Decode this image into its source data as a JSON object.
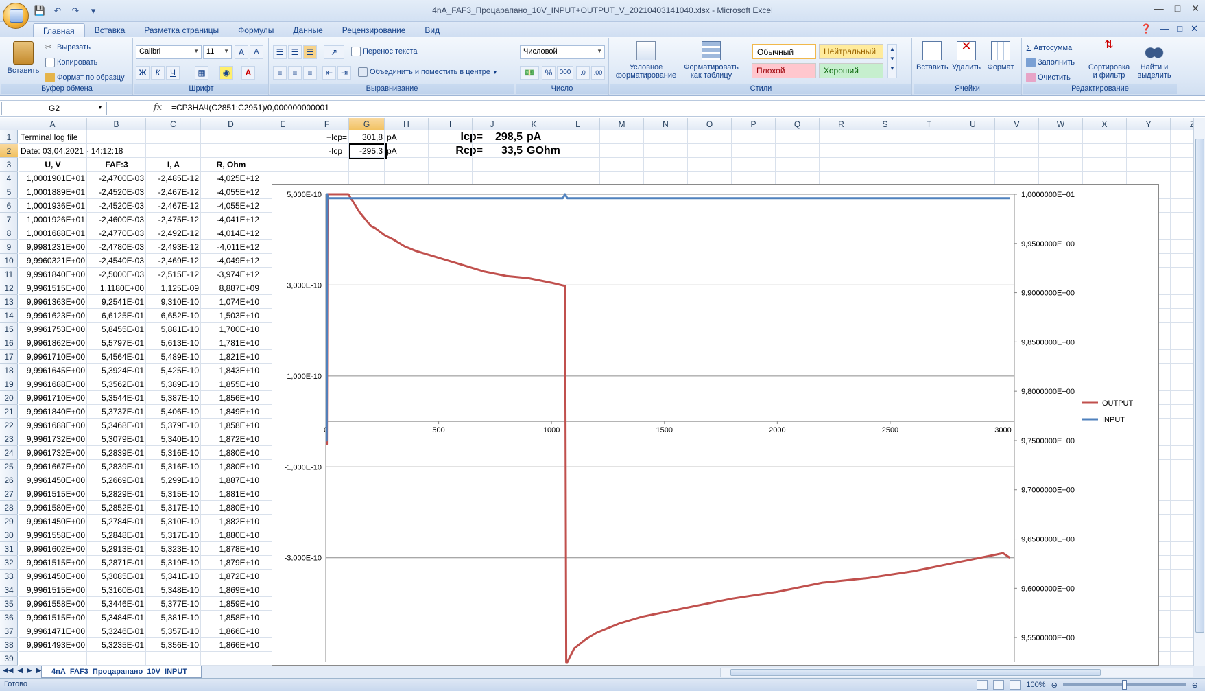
{
  "window": {
    "title": "4nA_FAF3_Процарапано_10V_INPUT+OUTPUT_V_20210403141040.xlsx - Microsoft Excel"
  },
  "ribbon": {
    "tabs": [
      "Главная",
      "Вставка",
      "Разметка страницы",
      "Формулы",
      "Данные",
      "Рецензирование",
      "Вид"
    ],
    "clipboard": {
      "label": "Буфер обмена",
      "paste": "Вставить",
      "cut": "Вырезать",
      "copy": "Копировать",
      "format_painter": "Формат по образцу"
    },
    "font": {
      "label": "Шрифт",
      "name": "Calibri",
      "size": "11",
      "bold": "Ж",
      "italic": "К",
      "underline": "Ч"
    },
    "alignment": {
      "label": "Выравнивание",
      "wrap": "Перенос текста",
      "merge": "Объединить и поместить в центре"
    },
    "number": {
      "label": "Число",
      "format": "Числовой",
      "percent": "%",
      "thousands": "000"
    },
    "styles": {
      "label": "Стили",
      "conditional": "Условное форматирование",
      "as_table": "Форматировать как таблицу",
      "normal": "Обычный",
      "neutral": "Нейтральный",
      "bad": "Плохой",
      "good": "Хороший"
    },
    "cells": {
      "label": "Ячейки",
      "insert": "Вставить",
      "delete": "Удалить",
      "format": "Формат"
    },
    "editing": {
      "label": "Редактирование",
      "autosum": "Автосумма",
      "fill": "Заполнить",
      "clear": "Очистить",
      "sort": "Сортировка и фильтр",
      "find": "Найти и выделить"
    }
  },
  "formula_bar": {
    "name_box": "G2",
    "fx": "fx",
    "formula": "=СРЗНАЧ(C2851:C2951)/0,000000000001"
  },
  "grid": {
    "columns": [
      "A",
      "B",
      "C",
      "D",
      "E",
      "F",
      "G",
      "H",
      "I",
      "J",
      "K",
      "L",
      "M",
      "N",
      "O",
      "P",
      "Q",
      "R",
      "S",
      "T",
      "U",
      "V",
      "W",
      "X",
      "Y",
      "Z"
    ],
    "selected_column": "G",
    "selected_row": 2,
    "row_numbers": [
      1,
      2,
      3,
      4,
      5,
      6,
      7,
      8,
      9,
      10,
      11,
      12,
      13,
      14,
      15,
      16,
      17,
      18,
      19,
      20,
      21,
      22,
      23,
      24,
      25,
      26,
      27,
      28,
      29,
      30,
      31,
      32,
      33,
      34,
      35,
      36,
      37,
      38,
      39
    ],
    "row1_a": "Terminal log file",
    "row2_a": "Date: 03,04,2021 - 14:12:18",
    "headers": [
      "U, V",
      "FAF:3",
      "I, A",
      "R, Ohm"
    ],
    "summary": {
      "plus_label": "+Icp=",
      "plus_value": "301,8",
      "plus_unit": "pA",
      "minus_label": "-Icp=",
      "minus_value": "-295,3",
      "minus_unit": "pA",
      "icp_label": "Icp=",
      "icp_value": "298,5",
      "icp_unit": "pA",
      "rcp_label": "Rcp=",
      "rcp_value": "33,5",
      "rcp_unit": "GOhm"
    },
    "rows": [
      [
        "1,0001901E+01",
        "-2,4700E-03",
        "-2,485E-12",
        "-4,025E+12"
      ],
      [
        "1,0001889E+01",
        "-2,4520E-03",
        "-2,467E-12",
        "-4,055E+12"
      ],
      [
        "1,0001936E+01",
        "-2,4520E-03",
        "-2,467E-12",
        "-4,055E+12"
      ],
      [
        "1,0001926E+01",
        "-2,4600E-03",
        "-2,475E-12",
        "-4,041E+12"
      ],
      [
        "1,0001688E+01",
        "-2,4770E-03",
        "-2,492E-12",
        "-4,014E+12"
      ],
      [
        "9,9981231E+00",
        "-2,4780E-03",
        "-2,493E-12",
        "-4,011E+12"
      ],
      [
        "9,9960321E+00",
        "-2,4540E-03",
        "-2,469E-12",
        "-4,049E+12"
      ],
      [
        "9,9961840E+00",
        "-2,5000E-03",
        "-2,515E-12",
        "-3,974E+12"
      ],
      [
        "9,9961515E+00",
        "1,1180E+00",
        "1,125E-09",
        "8,887E+09"
      ],
      [
        "9,9961363E+00",
        "9,2541E-01",
        "9,310E-10",
        "1,074E+10"
      ],
      [
        "9,9961623E+00",
        "6,6125E-01",
        "6,652E-10",
        "1,503E+10"
      ],
      [
        "9,9961753E+00",
        "5,8455E-01",
        "5,881E-10",
        "1,700E+10"
      ],
      [
        "9,9961862E+00",
        "5,5797E-01",
        "5,613E-10",
        "1,781E+10"
      ],
      [
        "9,9961710E+00",
        "5,4564E-01",
        "5,489E-10",
        "1,821E+10"
      ],
      [
        "9,9961645E+00",
        "5,3924E-01",
        "5,425E-10",
        "1,843E+10"
      ],
      [
        "9,9961688E+00",
        "5,3562E-01",
        "5,389E-10",
        "1,855E+10"
      ],
      [
        "9,9961710E+00",
        "5,3544E-01",
        "5,387E-10",
        "1,856E+10"
      ],
      [
        "9,9961840E+00",
        "5,3737E-01",
        "5,406E-10",
        "1,849E+10"
      ],
      [
        "9,9961688E+00",
        "5,3468E-01",
        "5,379E-10",
        "1,858E+10"
      ],
      [
        "9,9961732E+00",
        "5,3079E-01",
        "5,340E-10",
        "1,872E+10"
      ],
      [
        "9,9961732E+00",
        "5,2839E-01",
        "5,316E-10",
        "1,880E+10"
      ],
      [
        "9,9961667E+00",
        "5,2839E-01",
        "5,316E-10",
        "1,880E+10"
      ],
      [
        "9,9961450E+00",
        "5,2669E-01",
        "5,299E-10",
        "1,887E+10"
      ],
      [
        "9,9961515E+00",
        "5,2829E-01",
        "5,315E-10",
        "1,881E+10"
      ],
      [
        "9,9961580E+00",
        "5,2852E-01",
        "5,317E-10",
        "1,880E+10"
      ],
      [
        "9,9961450E+00",
        "5,2784E-01",
        "5,310E-10",
        "1,882E+10"
      ],
      [
        "9,9961558E+00",
        "5,2848E-01",
        "5,317E-10",
        "1,880E+10"
      ],
      [
        "9,9961602E+00",
        "5,2913E-01",
        "5,323E-10",
        "1,878E+10"
      ],
      [
        "9,9961515E+00",
        "5,2871E-01",
        "5,319E-10",
        "1,879E+10"
      ],
      [
        "9,9961450E+00",
        "5,3085E-01",
        "5,341E-10",
        "1,872E+10"
      ],
      [
        "9,9961515E+00",
        "5,3160E-01",
        "5,348E-10",
        "1,869E+10"
      ],
      [
        "9,9961558E+00",
        "5,3446E-01",
        "5,377E-10",
        "1,859E+10"
      ],
      [
        "9,9961515E+00",
        "5,3484E-01",
        "5,381E-10",
        "1,858E+10"
      ],
      [
        "9,9961471E+00",
        "5,3246E-01",
        "5,357E-10",
        "1,866E+10"
      ],
      [
        "9,9961493E+00",
        "5,3235E-01",
        "5,356E-10",
        "1,866E+10"
      ]
    ]
  },
  "chart_data": {
    "type": "line",
    "x_ticks": [
      "0",
      "500",
      "1000",
      "1500",
      "2000",
      "2500",
      "3000"
    ],
    "xlim": [
      0,
      3050
    ],
    "y_left_ticks": [
      "5,000E-10",
      "3,000E-10",
      "1,000E-10",
      "-1,000E-10",
      "-3,000E-10"
    ],
    "ylim_left": [
      -5.3e-10,
      5e-10
    ],
    "y_right_ticks": [
      "1,0000000E+01",
      "9,9500000E+00",
      "9,9000000E+00",
      "9,8500000E+00",
      "9,8000000E+00",
      "9,7500000E+00",
      "9,7000000E+00",
      "9,6500000E+00",
      "9,6000000E+00",
      "9,5500000E+00"
    ],
    "ylim_right": [
      9.525,
      10.0
    ],
    "grid": true,
    "legend_position": "right",
    "series": [
      {
        "name": "OUTPUT",
        "axis": "left",
        "color": "#c0504d",
        "x": [
          0,
          5,
          8,
          10,
          60,
          100,
          150,
          200,
          220,
          260,
          300,
          350,
          400,
          500,
          600,
          700,
          800,
          900,
          1000,
          1060,
          1062,
          1065,
          1070,
          1100,
          1150,
          1200,
          1300,
          1400,
          1450,
          1500,
          1600,
          1800,
          2000,
          2200,
          2400,
          2600,
          2800,
          3000,
          3030
        ],
        "y": [
          -5e-11,
          -5e-11,
          5e-10,
          5e-10,
          5e-10,
          5e-10,
          4.6e-10,
          4.3e-10,
          4.25e-10,
          4.1e-10,
          4e-10,
          3.85e-10,
          3.75e-10,
          3.6e-10,
          3.45e-10,
          3.3e-10,
          3.2e-10,
          3.15e-10,
          3.05e-10,
          2.98e-10,
          0,
          -5.3e-10,
          -5.3e-10,
          -5e-10,
          -4.8e-10,
          -4.65e-10,
          -4.45e-10,
          -4.3e-10,
          -4.25e-10,
          -4.2e-10,
          -4.1e-10,
          -3.9e-10,
          -3.75e-10,
          -3.55e-10,
          -3.45e-10,
          -3.3e-10,
          -3.1e-10,
          -2.9e-10,
          -3e-10
        ]
      },
      {
        "name": "INPUT",
        "axis": "right",
        "color": "#4f81bd",
        "x": [
          0,
          4,
          6,
          8,
          500,
          1000,
          1050,
          1060,
          1070,
          1500,
          2000,
          2500,
          3000,
          3030
        ],
        "y": [
          9.75,
          9.75,
          10.0,
          9.996,
          9.996,
          9.996,
          9.996,
          10.0,
          9.996,
          9.996,
          9.996,
          9.996,
          9.996,
          9.996
        ]
      }
    ]
  },
  "sheet": {
    "tab": "4nA_FAF3_Процарапано_10V_INPUT_"
  },
  "status": {
    "ready": "Готово",
    "zoom": "100%"
  }
}
